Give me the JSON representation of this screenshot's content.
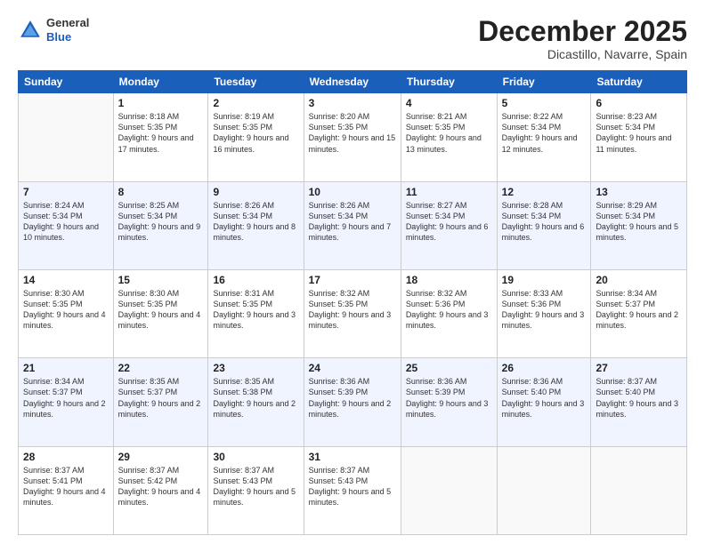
{
  "logo": {
    "general": "General",
    "blue": "Blue"
  },
  "header": {
    "month": "December 2025",
    "location": "Dicastillo, Navarre, Spain"
  },
  "weekdays": [
    "Sunday",
    "Monday",
    "Tuesday",
    "Wednesday",
    "Thursday",
    "Friday",
    "Saturday"
  ],
  "weeks": [
    [
      {
        "day": null,
        "info": null
      },
      {
        "day": "1",
        "sunrise": "8:18 AM",
        "sunset": "5:35 PM",
        "daylight": "9 hours and 17 minutes."
      },
      {
        "day": "2",
        "sunrise": "8:19 AM",
        "sunset": "5:35 PM",
        "daylight": "9 hours and 16 minutes."
      },
      {
        "day": "3",
        "sunrise": "8:20 AM",
        "sunset": "5:35 PM",
        "daylight": "9 hours and 15 minutes."
      },
      {
        "day": "4",
        "sunrise": "8:21 AM",
        "sunset": "5:35 PM",
        "daylight": "9 hours and 13 minutes."
      },
      {
        "day": "5",
        "sunrise": "8:22 AM",
        "sunset": "5:34 PM",
        "daylight": "9 hours and 12 minutes."
      },
      {
        "day": "6",
        "sunrise": "8:23 AM",
        "sunset": "5:34 PM",
        "daylight": "9 hours and 11 minutes."
      }
    ],
    [
      {
        "day": "7",
        "sunrise": "8:24 AM",
        "sunset": "5:34 PM",
        "daylight": "9 hours and 10 minutes."
      },
      {
        "day": "8",
        "sunrise": "8:25 AM",
        "sunset": "5:34 PM",
        "daylight": "9 hours and 9 minutes."
      },
      {
        "day": "9",
        "sunrise": "8:26 AM",
        "sunset": "5:34 PM",
        "daylight": "9 hours and 8 minutes."
      },
      {
        "day": "10",
        "sunrise": "8:26 AM",
        "sunset": "5:34 PM",
        "daylight": "9 hours and 7 minutes."
      },
      {
        "day": "11",
        "sunrise": "8:27 AM",
        "sunset": "5:34 PM",
        "daylight": "9 hours and 6 minutes."
      },
      {
        "day": "12",
        "sunrise": "8:28 AM",
        "sunset": "5:34 PM",
        "daylight": "9 hours and 6 minutes."
      },
      {
        "day": "13",
        "sunrise": "8:29 AM",
        "sunset": "5:34 PM",
        "daylight": "9 hours and 5 minutes."
      }
    ],
    [
      {
        "day": "14",
        "sunrise": "8:30 AM",
        "sunset": "5:35 PM",
        "daylight": "9 hours and 4 minutes."
      },
      {
        "day": "15",
        "sunrise": "8:30 AM",
        "sunset": "5:35 PM",
        "daylight": "9 hours and 4 minutes."
      },
      {
        "day": "16",
        "sunrise": "8:31 AM",
        "sunset": "5:35 PM",
        "daylight": "9 hours and 3 minutes."
      },
      {
        "day": "17",
        "sunrise": "8:32 AM",
        "sunset": "5:35 PM",
        "daylight": "9 hours and 3 minutes."
      },
      {
        "day": "18",
        "sunrise": "8:32 AM",
        "sunset": "5:36 PM",
        "daylight": "9 hours and 3 minutes."
      },
      {
        "day": "19",
        "sunrise": "8:33 AM",
        "sunset": "5:36 PM",
        "daylight": "9 hours and 3 minutes."
      },
      {
        "day": "20",
        "sunrise": "8:34 AM",
        "sunset": "5:37 PM",
        "daylight": "9 hours and 2 minutes."
      }
    ],
    [
      {
        "day": "21",
        "sunrise": "8:34 AM",
        "sunset": "5:37 PM",
        "daylight": "9 hours and 2 minutes."
      },
      {
        "day": "22",
        "sunrise": "8:35 AM",
        "sunset": "5:37 PM",
        "daylight": "9 hours and 2 minutes."
      },
      {
        "day": "23",
        "sunrise": "8:35 AM",
        "sunset": "5:38 PM",
        "daylight": "9 hours and 2 minutes."
      },
      {
        "day": "24",
        "sunrise": "8:36 AM",
        "sunset": "5:39 PM",
        "daylight": "9 hours and 2 minutes."
      },
      {
        "day": "25",
        "sunrise": "8:36 AM",
        "sunset": "5:39 PM",
        "daylight": "9 hours and 3 minutes."
      },
      {
        "day": "26",
        "sunrise": "8:36 AM",
        "sunset": "5:40 PM",
        "daylight": "9 hours and 3 minutes."
      },
      {
        "day": "27",
        "sunrise": "8:37 AM",
        "sunset": "5:40 PM",
        "daylight": "9 hours and 3 minutes."
      }
    ],
    [
      {
        "day": "28",
        "sunrise": "8:37 AM",
        "sunset": "5:41 PM",
        "daylight": "9 hours and 4 minutes."
      },
      {
        "day": "29",
        "sunrise": "8:37 AM",
        "sunset": "5:42 PM",
        "daylight": "9 hours and 4 minutes."
      },
      {
        "day": "30",
        "sunrise": "8:37 AM",
        "sunset": "5:43 PM",
        "daylight": "9 hours and 5 minutes."
      },
      {
        "day": "31",
        "sunrise": "8:37 AM",
        "sunset": "5:43 PM",
        "daylight": "9 hours and 5 minutes."
      },
      {
        "day": null,
        "info": null
      },
      {
        "day": null,
        "info": null
      },
      {
        "day": null,
        "info": null
      }
    ]
  ]
}
